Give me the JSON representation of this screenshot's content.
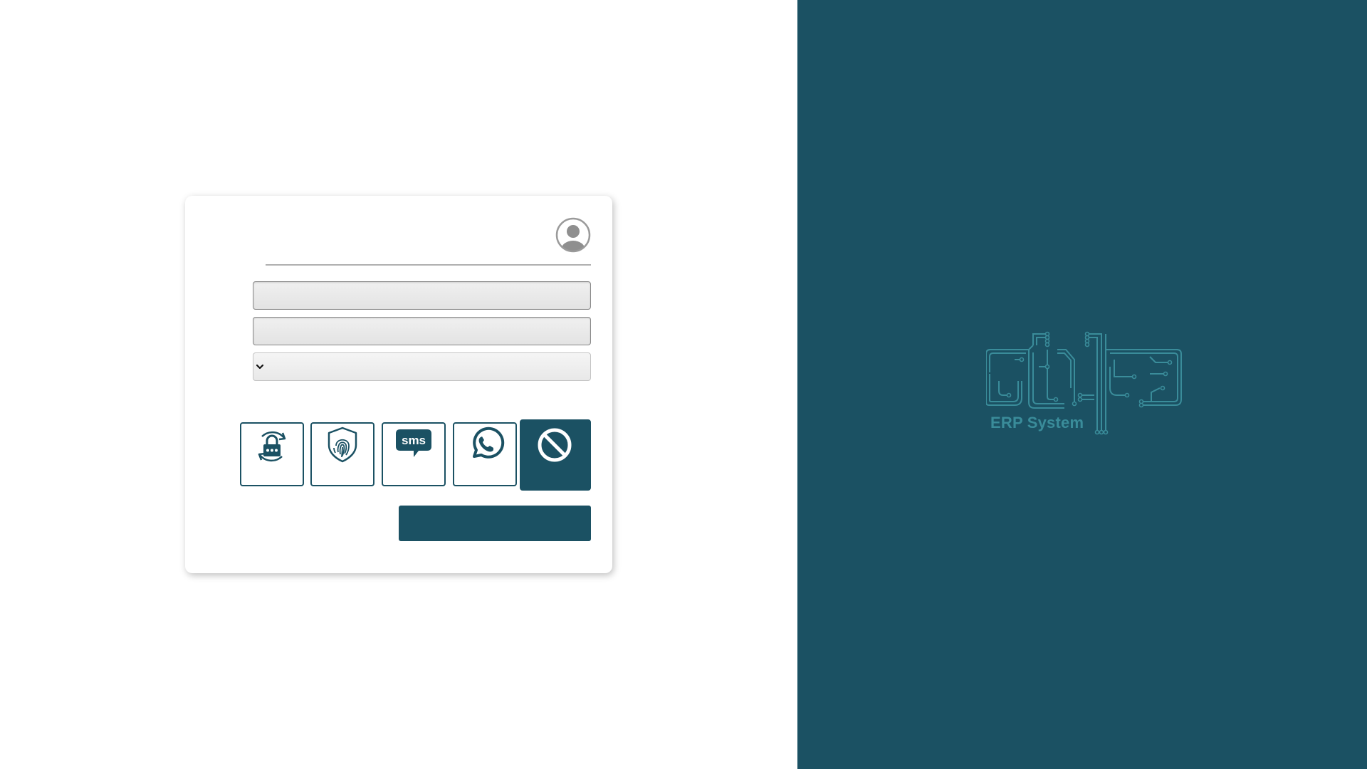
{
  "colors": {
    "brand_dark": "#1b5163",
    "logo_accent": "#3a8c9a",
    "page_background": "#ffffff"
  },
  "login_form": {
    "avatar_icon": "user-circle-icon",
    "username": {
      "value": "",
      "placeholder": ""
    },
    "password": {
      "value": "",
      "placeholder": ""
    },
    "company_select": {
      "selected": "",
      "icon": "chevron-down-icon"
    },
    "auth_methods": [
      {
        "name": "password-reset",
        "icon": "lock-refresh-icon"
      },
      {
        "name": "fingerprint",
        "icon": "fingerprint-shield-icon"
      },
      {
        "name": "sms",
        "icon": "sms-bubble-icon",
        "label": "sms"
      },
      {
        "name": "whatsapp",
        "icon": "whatsapp-icon"
      },
      {
        "name": "none",
        "icon": "no-entry-icon",
        "selected": true
      }
    ],
    "submit_label": ""
  },
  "brand_panel": {
    "logo_icon": "circuit-logo-icon",
    "logo_text": "ERP System"
  }
}
